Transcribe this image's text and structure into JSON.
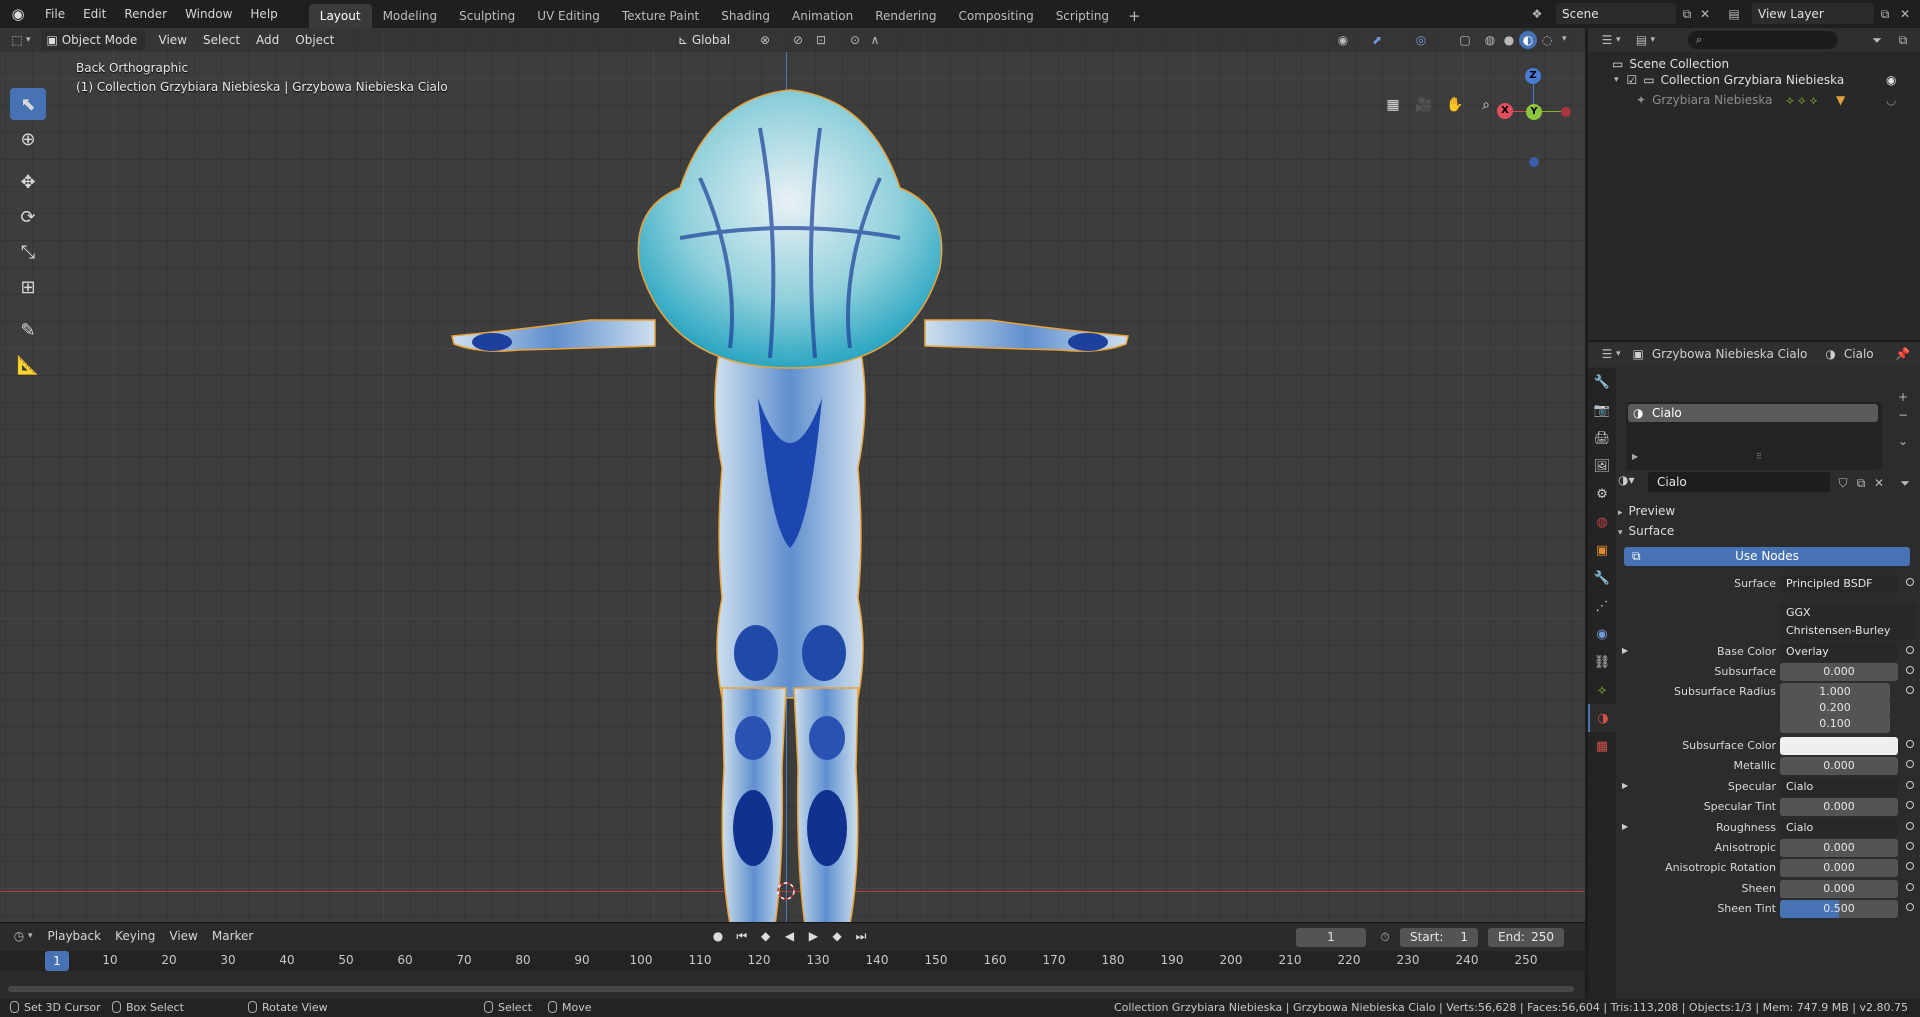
{
  "menubar": {
    "menus": [
      "File",
      "Edit",
      "Render",
      "Window",
      "Help"
    ],
    "workspaces": [
      "Layout",
      "Modeling",
      "Sculpting",
      "UV Editing",
      "Texture Paint",
      "Shading",
      "Animation",
      "Rendering",
      "Compositing",
      "Scripting"
    ],
    "active_workspace": "Layout",
    "scene": "Scene",
    "view_layer": "View Layer"
  },
  "viewport": {
    "mode": "Object Mode",
    "menus": [
      "View",
      "Select",
      "Add",
      "Object"
    ],
    "orientation": "Global",
    "view_name": "Back Orthographic",
    "collection_info": "(1) Collection Grzybiara Niebieska | Grzybowa Niebieska Cialo",
    "gizmo": {
      "z": "Z",
      "x": "X",
      "y": "Y"
    }
  },
  "timeline": {
    "menus": [
      "Playback",
      "Keying",
      "View",
      "Marker"
    ],
    "current_frame": "1",
    "start_label": "Start:",
    "start": "1",
    "end_label": "End:",
    "end": "250",
    "ticks": [
      "10",
      "20",
      "30",
      "40",
      "50",
      "60",
      "70",
      "80",
      "90",
      "100",
      "110",
      "120",
      "130",
      "140",
      "150",
      "160",
      "170",
      "180",
      "190",
      "200",
      "210",
      "220",
      "230",
      "240",
      "250"
    ],
    "marker": "1"
  },
  "statusbar": {
    "left_action": "Set 3D Cursor",
    "box_select": "Box Select",
    "rotate": "Rotate View",
    "select": "Select",
    "move": "Move",
    "info": "Collection Grzybiara Niebieska | Grzybowa Niebieska Cialo | Verts:56,628 | Faces:56,604 | Tris:113,208 | Objects:1/3 | Mem: 747.9 MB | v2.80.75"
  },
  "outliner": {
    "root": "Scene Collection",
    "collection": "Collection Grzybiara Niebieska",
    "object": "Grzybiara Niebieska"
  },
  "properties": {
    "object_name": "Grzybowa Niebieska Cialo",
    "material_name": "Cialo",
    "slot": "Cialo",
    "material_field": "Cialo",
    "panel_preview": "Preview",
    "panel_surface": "Surface",
    "use_nodes": "Use Nodes",
    "rows": [
      {
        "label": "Surface",
        "value": "Principled BSDF",
        "kind": "menu"
      },
      {
        "label": "",
        "value": "GGX",
        "kind": "menu"
      },
      {
        "label": "",
        "value": "Christensen-Burley",
        "kind": "menu"
      },
      {
        "label": "Base Color",
        "value": "Overlay",
        "kind": "menu"
      },
      {
        "label": "Subsurface",
        "value": "0.000",
        "kind": "num"
      },
      {
        "label": "Subsurface Radius",
        "value": "1.000",
        "kind": "num"
      },
      {
        "label": "",
        "value": "0.200",
        "kind": "num"
      },
      {
        "label": "",
        "value": "0.100",
        "kind": "num"
      },
      {
        "label": "Subsurface Color",
        "value": "",
        "kind": "color"
      },
      {
        "label": "Metallic",
        "value": "0.000",
        "kind": "num"
      },
      {
        "label": "Specular",
        "value": "Cialo grzy..eska_s.png",
        "kind": "menu"
      },
      {
        "label": "Specular Tint",
        "value": "0.000",
        "kind": "num"
      },
      {
        "label": "Roughness",
        "value": "Cialo grzy..eska_r.png",
        "kind": "menu"
      },
      {
        "label": "Anisotropic",
        "value": "0.000",
        "kind": "num"
      },
      {
        "label": "Anisotropic Rotation",
        "value": "0.000",
        "kind": "num"
      },
      {
        "label": "Sheen",
        "value": "0.000",
        "kind": "num"
      },
      {
        "label": "Sheen Tint",
        "value": "0.500",
        "kind": "active"
      }
    ]
  },
  "colors": {
    "accent": "#4772b3",
    "selection_outline": "#e8a33a"
  }
}
